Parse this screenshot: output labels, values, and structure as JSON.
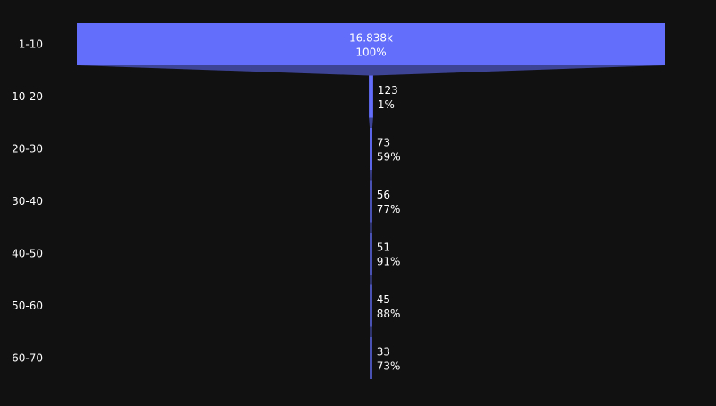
{
  "chart_data": {
    "type": "funnel",
    "title": "",
    "xlabel": "",
    "ylabel": "",
    "categories": [
      "1-10",
      "10-20",
      "20-30",
      "30-40",
      "40-50",
      "50-60",
      "60-70"
    ],
    "values": [
      16838,
      123,
      73,
      56,
      51,
      45,
      33
    ],
    "value_labels": [
      "16.838k",
      "123",
      "73",
      "56",
      "51",
      "45",
      "33"
    ],
    "percent_labels": [
      "100%",
      "1%",
      "59%",
      "77%",
      "91%",
      "88%",
      "73%"
    ],
    "percent_mode": "percent of previous",
    "legend": "none",
    "grid": false,
    "colors": {
      "background": "#111111",
      "bar": "#636efa",
      "connector": "#3d4395",
      "text": "#ffffff"
    }
  }
}
